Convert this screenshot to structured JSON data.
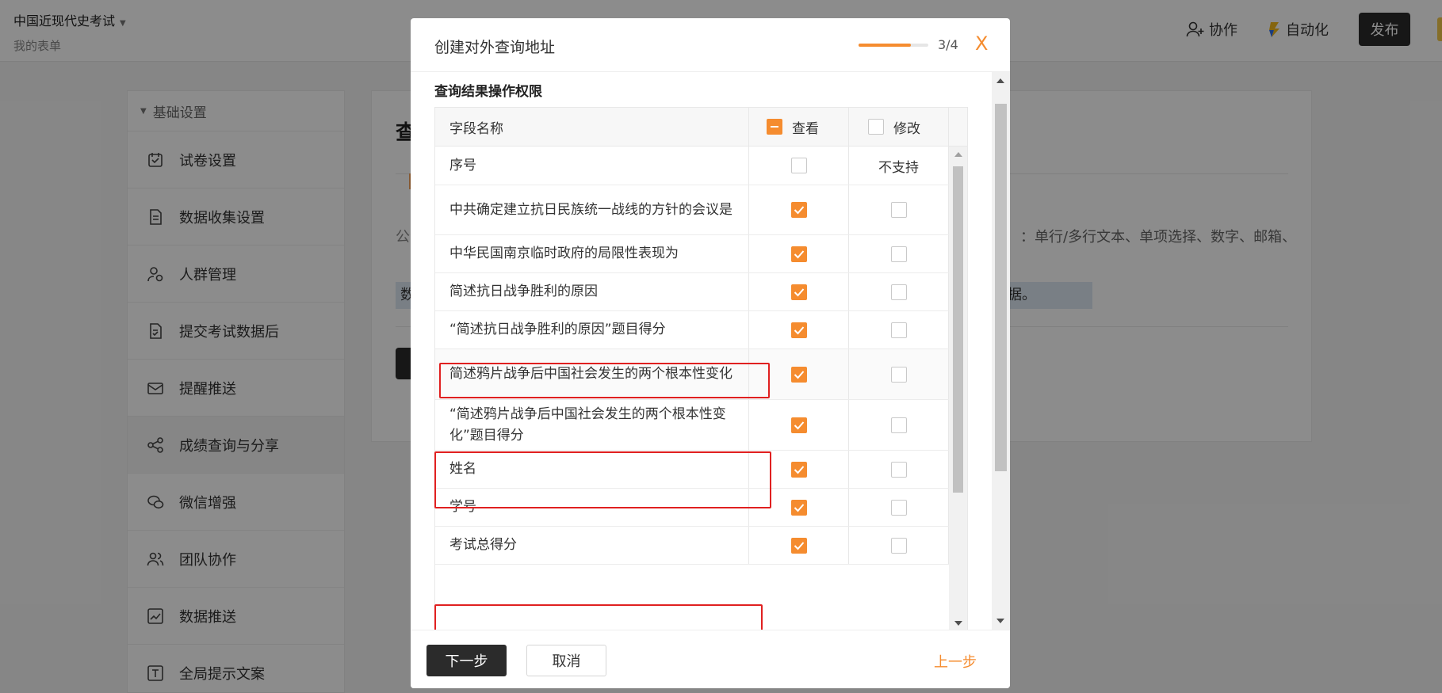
{
  "app": {
    "title": "中国近现代史考试",
    "subtitle": "我的表单",
    "collab_label": "协作",
    "automation_label": "自动化",
    "publish_label": "发布"
  },
  "sidebar": {
    "group_label": "基础设置",
    "items": [
      {
        "label": "试卷设置",
        "icon": "exam-icon"
      },
      {
        "label": "数据收集设置",
        "icon": "document-icon"
      },
      {
        "label": "人群管理",
        "icon": "user-settings-icon"
      },
      {
        "label": "提交考试数据后",
        "icon": "submit-doc-icon"
      },
      {
        "label": "提醒推送",
        "icon": "envelope-icon"
      },
      {
        "label": "成绩查询与分享",
        "icon": "share-icon"
      },
      {
        "label": "微信增强",
        "icon": "wechat-icon"
      },
      {
        "label": "团队协作",
        "icon": "team-icon"
      },
      {
        "label": "数据推送",
        "icon": "chart-icon"
      },
      {
        "label": "全局提示文案",
        "icon": "text-icon"
      }
    ]
  },
  "content": {
    "title_fragment": "查",
    "text_left": "公众",
    "text_right": "：单行/多行文本、单项选择、数字、邮箱、",
    "highlight_left": "数",
    "highlight_right": "数据。"
  },
  "modal": {
    "title": "创建对外查询地址",
    "step_text": "3/4",
    "progress_fraction": 0.75,
    "close_glyph": "X",
    "section_title": "查询结果操作权限",
    "table": {
      "headers": {
        "field": "字段名称",
        "view": "查看",
        "edit": "修改"
      },
      "rows": [
        {
          "field": "序号",
          "view": false,
          "edit": "不支持"
        },
        {
          "field": "中共确定建立抗日民族统一战线的方针的会议是",
          "view": true,
          "edit": false
        },
        {
          "field": "中华民国南京临时政府的局限性表现为",
          "view": true,
          "edit": false
        },
        {
          "field": "简述抗日战争胜利的原因",
          "view": true,
          "edit": false
        },
        {
          "field": "“简述抗日战争胜利的原因”题目得分",
          "view": true,
          "edit": false
        },
        {
          "field": "简述鸦片战争后中国社会发生的两个根本性变化",
          "view": true,
          "edit": false
        },
        {
          "field": "“简述鸦片战争后中国社会发生的两个根本性变化”题目得分",
          "view": true,
          "edit": false
        },
        {
          "field": "姓名",
          "view": true,
          "edit": false
        },
        {
          "field": "学号",
          "view": true,
          "edit": false
        },
        {
          "field": "考试总得分",
          "view": true,
          "edit": false
        }
      ]
    },
    "footer": {
      "next_label": "下一步",
      "cancel_label": "取消",
      "prev_label": "上一步"
    }
  },
  "colors": {
    "accent": "#f58c2f",
    "dark_button": "#2b2b2b",
    "highlight_border": "#e02020"
  }
}
